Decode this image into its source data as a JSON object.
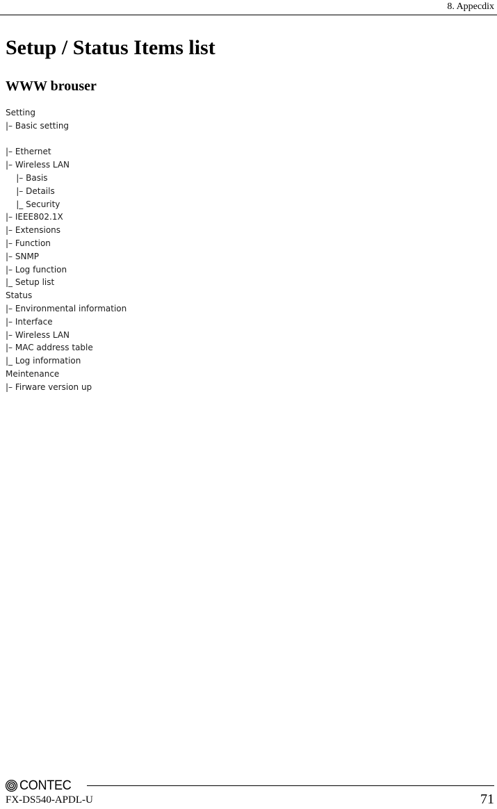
{
  "header": {
    "chapter_label": "8. Appecdix"
  },
  "main": {
    "title": "Setup / Status Items list",
    "subtitle": "WWW brouser",
    "tree": [
      {
        "text": "Setting",
        "type": "root"
      },
      {
        "text": "|– Basic setting",
        "type": "branch"
      },
      {
        "text": "",
        "type": "spacer"
      },
      {
        "text": "|– Ethernet",
        "type": "branch"
      },
      {
        "text": "|– Wireless LAN",
        "type": "branch"
      },
      {
        "text": "    |– Basis",
        "type": "child"
      },
      {
        "text": "    |– Details",
        "type": "child"
      },
      {
        "text": "    |_ Security",
        "type": "child-last"
      },
      {
        "text": "|– IEEE802.1X",
        "type": "branch"
      },
      {
        "text": "|– Extensions",
        "type": "branch"
      },
      {
        "text": "|– Function",
        "type": "branch"
      },
      {
        "text": "|– SNMP",
        "type": "branch"
      },
      {
        "text": "|– Log function",
        "type": "branch"
      },
      {
        "text": "|_ Setup list",
        "type": "branch-last"
      },
      {
        "text": "Status",
        "type": "root"
      },
      {
        "text": "|– Environmental information",
        "type": "branch"
      },
      {
        "text": "|– Interface",
        "type": "branch"
      },
      {
        "text": "|– Wireless LAN",
        "type": "branch"
      },
      {
        "text": "|– MAC address table",
        "type": "branch"
      },
      {
        "text": "|_ Log information",
        "type": "branch-last"
      },
      {
        "text": "Meintenance",
        "type": "root"
      },
      {
        "text": "|– Firware version up",
        "type": "branch"
      }
    ]
  },
  "footer": {
    "brand_name": "CONTEC",
    "brand_mark_icon": "contec-spiral-logo-icon",
    "model": "FX-DS540-APDL-U",
    "page_number": "71"
  }
}
